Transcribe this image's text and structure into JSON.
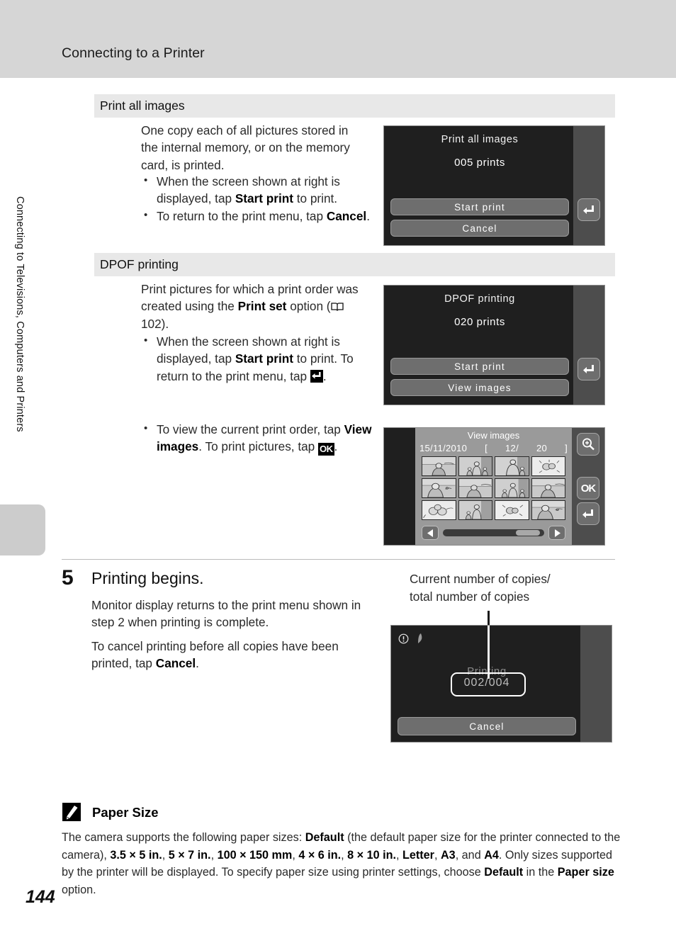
{
  "header": {
    "title": "Connecting to a Printer"
  },
  "sidebar": {
    "vertical_label": "Connecting to Televisions, Computers and Printers",
    "page_number": "144"
  },
  "sections": {
    "print_all_images": {
      "bar_label": "Print all images",
      "intro": "One copy each of all pictures stored in the internal memory, or on the memory card, is printed.",
      "bullets": [
        {
          "pre": "When the screen shown at right is displayed, tap ",
          "bold": "Start print",
          "post": " to print."
        },
        {
          "pre": "To return to the print menu, tap ",
          "bold": "Cancel",
          "post": "."
        }
      ],
      "screen": {
        "title": "Print all images",
        "count": "005 prints",
        "buttons": [
          "Start print",
          "Cancel"
        ],
        "rail_icon": "back-arrow-icon"
      }
    },
    "dpof_printing": {
      "bar_label": "DPOF printing",
      "intro_pre": "Print pictures for which a print order was created using the ",
      "intro_bold": "Print set",
      "intro_mid": " option (",
      "intro_ref": " 102).",
      "bullets": [
        {
          "pre": "When the screen shown at right is displayed, tap ",
          "bold": "Start print",
          "post": " to print. To return to the print menu, tap ",
          "icon": "back-arrow-icon",
          "tail": "."
        },
        {
          "pre": "To view the current print order, tap ",
          "bold": "View images",
          "post": ". To print pictures, tap ",
          "icon": "ok-icon",
          "tail": "."
        }
      ],
      "screen": {
        "title": "DPOF printing",
        "count": "020 prints",
        "buttons": [
          "Start print",
          "View images"
        ],
        "rail_icon": "back-arrow-icon"
      },
      "grid_screen": {
        "title": "View images",
        "date": "15/11/2010",
        "counter_open": "[",
        "counter_current": "12/",
        "counter_total": "20",
        "counter_close": "]",
        "rail_buttons": [
          "zoom-in-icon",
          "OK",
          "back-arrow-icon"
        ],
        "nav_left": "◀",
        "nav_right": "▶"
      }
    }
  },
  "step5": {
    "number": "5",
    "title": "Printing begins.",
    "para1": "Monitor display returns to the print menu shown in step 2 when printing is complete.",
    "para2_pre": "To cancel printing before all copies have been ",
    "para2_mid": "printed, tap ",
    "para2_bold": "Cancel",
    "para2_post": ".",
    "callout": "Current number of copies/ total number of copies",
    "callout_line1": "Current number of copies/",
    "callout_line2": "total number of copies",
    "screen": {
      "status_label": "Printing",
      "progress": "002/004",
      "cancel_label": "Cancel",
      "status_icons": [
        "warning-icon",
        "printer-icon"
      ]
    }
  },
  "note": {
    "icon": "pencil-note-icon",
    "title": "Paper Size",
    "segments": [
      {
        "t": "The camera supports the following paper sizes: ",
        "b": false
      },
      {
        "t": "Default",
        "b": true
      },
      {
        "t": " (the default paper size for the printer connected to the camera), ",
        "b": false
      },
      {
        "t": "3.5 × 5 in.",
        "b": true
      },
      {
        "t": ", ",
        "b": false
      },
      {
        "t": "5 × 7 in.",
        "b": true
      },
      {
        "t": ", ",
        "b": false
      },
      {
        "t": "100 × 150 mm",
        "b": true
      },
      {
        "t": ", ",
        "b": false
      },
      {
        "t": "4 × 6 in.",
        "b": true
      },
      {
        "t": ", ",
        "b": false
      },
      {
        "t": "8 × 10 in.",
        "b": true
      },
      {
        "t": ", ",
        "b": false
      },
      {
        "t": "Letter",
        "b": true
      },
      {
        "t": ", ",
        "b": false
      },
      {
        "t": "A3",
        "b": true
      },
      {
        "t": ", and ",
        "b": false
      },
      {
        "t": "A4",
        "b": true
      },
      {
        "t": ". Only sizes supported by the printer will be displayed. To specify paper size using printer settings, choose ",
        "b": false
      },
      {
        "t": "Default",
        "b": true
      },
      {
        "t": " in the ",
        "b": false
      },
      {
        "t": "Paper size",
        "b": true
      },
      {
        "t": " option.",
        "b": false
      }
    ]
  },
  "colors": {
    "header_bg": "#d6d6d6",
    "section_bar_bg": "#e8e8e8",
    "screen_bg": "#1f1f1f",
    "rail_bg": "#4d4d4d",
    "button_bg": "#6e6e6e"
  }
}
